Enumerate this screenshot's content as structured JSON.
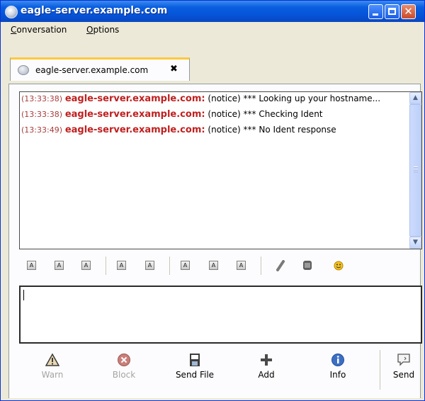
{
  "window": {
    "title": "eagle-server.example.com"
  },
  "menu": {
    "conversation_u": "C",
    "conversation_rest": "onversation",
    "options_u": "O",
    "options_rest": "ptions"
  },
  "tab": {
    "label": "eagle-server.example.com",
    "close_glyph": "✖"
  },
  "log": {
    "messages": [
      {
        "time": "(13:33:38)",
        "sender": "eagle-server.example.com:",
        "text": "(notice) *** Looking up your hostname..."
      },
      {
        "time": "(13:33:38)",
        "sender": "eagle-server.example.com:",
        "text": "(notice) *** Checking Ident"
      },
      {
        "time": "(13:33:49)",
        "sender": "eagle-server.example.com:",
        "text": "(notice) *** No Ident response"
      }
    ]
  },
  "format_toolbar": {
    "buttons": [
      "bold-icon",
      "italic-icon",
      "underline-icon",
      "grow-font-icon",
      "shrink-font-icon",
      "background-color-icon",
      "font-icon",
      "foreground-color-icon",
      "link-icon",
      "image-icon",
      "smiley-icon"
    ]
  },
  "entry": {
    "value": ""
  },
  "actions": {
    "warn": "Warn",
    "block": "Block",
    "send_file": "Send File",
    "add": "Add",
    "info": "Info",
    "send": "Send"
  },
  "colors": {
    "titlebar": "#0553d6",
    "sender": "#c02020",
    "timestamp": "#a83c3c",
    "tab_accent": "#ffc83c"
  }
}
